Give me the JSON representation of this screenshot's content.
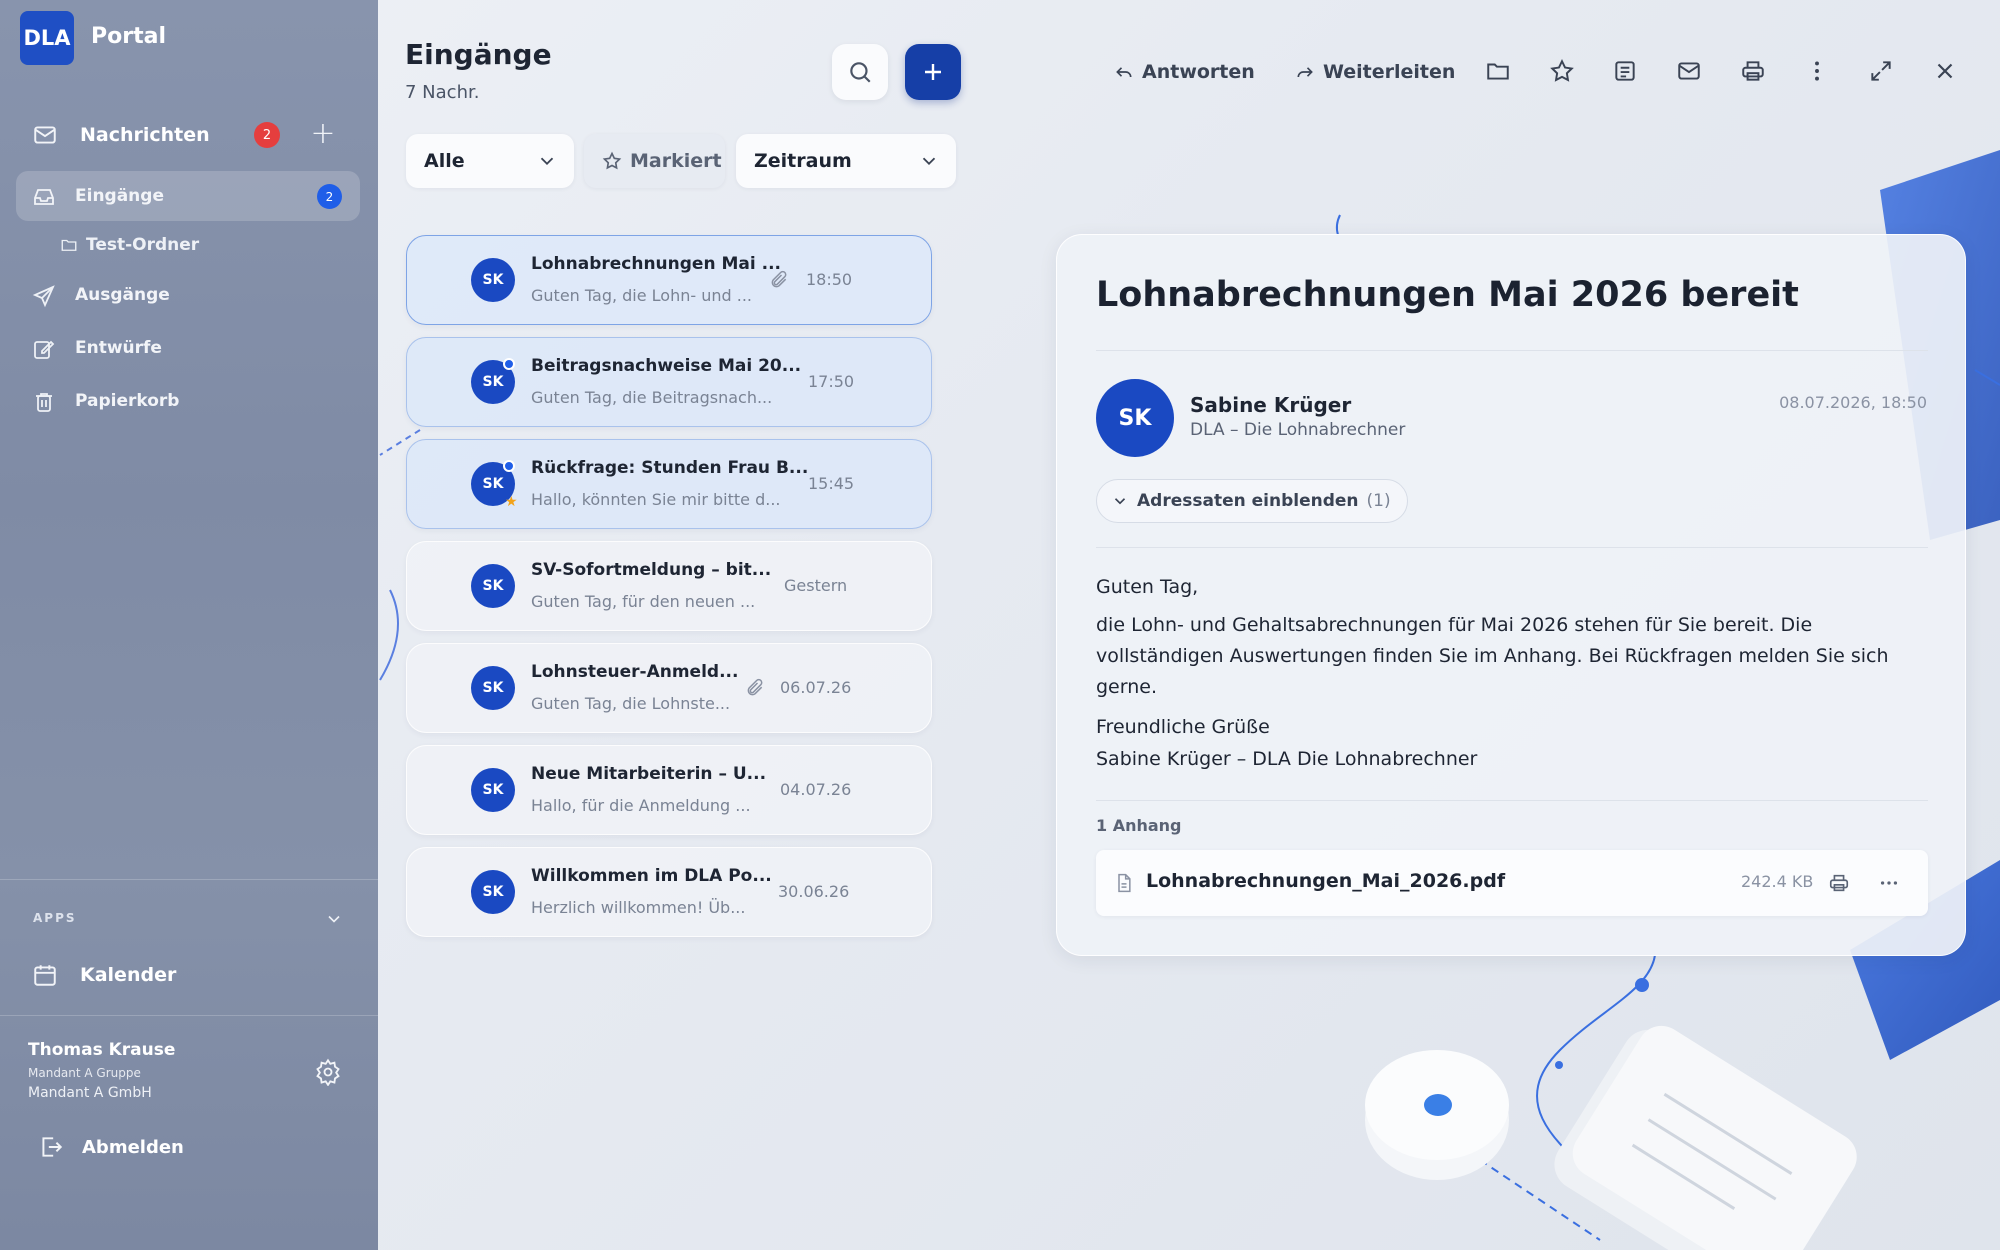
{
  "app": {
    "logo": "DLA",
    "brand": "Portal"
  },
  "sidebar": {
    "messages_label": "Nachrichten",
    "messages_badge": "2",
    "items": [
      {
        "label": "Eingänge",
        "badge": "2",
        "icon": "inbox-icon",
        "active": true
      },
      {
        "label": "Test-Ordner",
        "icon": "folder-icon"
      },
      {
        "label": "Ausgänge",
        "icon": "send-icon"
      },
      {
        "label": "Entwürfe",
        "icon": "edit-icon"
      },
      {
        "label": "Papierkorb",
        "icon": "trash-icon"
      }
    ],
    "apps_label": "APPS",
    "apps": [
      {
        "label": "Kalender",
        "icon": "calendar-icon"
      }
    ],
    "user": {
      "name": "Thomas Krause",
      "group": "Mandant A Gruppe",
      "company": "Mandant A GmbH"
    },
    "logout_label": "Abmelden"
  },
  "header": {
    "title": "Eingänge",
    "count": "7 Nachr.",
    "reply_label": "Antworten",
    "forward_label": "Weiterleiten"
  },
  "filters": {
    "status": "Alle",
    "marked": "Markiert",
    "period": "Zeitraum"
  },
  "messages": [
    {
      "initials": "SK",
      "subject": "Lohnabrechnungen Mai ...",
      "preview": "Guten Tag, die Lohn- und ...",
      "time": "18:50",
      "attachment": true,
      "unread": false,
      "starred": false
    },
    {
      "initials": "SK",
      "subject": "Beitragsnachweise Mai 20...",
      "preview": "Guten Tag, die Beitragsnach...",
      "time": "17:50",
      "attachment": false,
      "unread": true,
      "starred": false
    },
    {
      "initials": "SK",
      "subject": "Rückfrage: Stunden Frau B...",
      "preview": "Hallo, könnten Sie mir bitte d...",
      "time": "15:45",
      "attachment": false,
      "unread": true,
      "starred": true
    },
    {
      "initials": "SK",
      "subject": "SV-Sofortmeldung – bit...",
      "preview": "Guten Tag, für den neuen ...",
      "time": "Gestern",
      "attachment": false,
      "unread": false,
      "starred": false
    },
    {
      "initials": "SK",
      "subject": "Lohnsteuer-Anmeld...",
      "preview": "Guten Tag, die Lohnste...",
      "time": "06.07.26",
      "attachment": true,
      "unread": false,
      "starred": false
    },
    {
      "initials": "SK",
      "subject": "Neue Mitarbeiterin – U...",
      "preview": "Hallo, für die Anmeldung ...",
      "time": "04.07.26",
      "attachment": false,
      "unread": false,
      "starred": false
    },
    {
      "initials": "SK",
      "subject": "Willkommen im DLA Po...",
      "preview": "Herzlich willkommen! Üb...",
      "time": "30.06.26",
      "attachment": false,
      "unread": false,
      "starred": false
    }
  ],
  "reader": {
    "title": "Lohnabrechnungen Mai 2026 bereit",
    "sender_initials": "SK",
    "sender": "Sabine Krüger",
    "sender_org": "DLA – Die Lohnabrechner",
    "date": "08.07.2026, 18:50",
    "recipients_label": "Adressaten einblenden",
    "recipients_count": "(1)",
    "body": {
      "greeting": "Guten Tag,",
      "text": "die Lohn- und Gehaltsabrechnungen für Mai 2026 stehen für Sie bereit. Die vollständigen Auswertungen finden Sie im Anhang. Bei Rückfragen melden Sie sich gerne.",
      "closing": "Freundliche Grüße",
      "signature": "Sabine Krüger – DLA Die Lohnabrechner"
    },
    "attachments_label": "1 Anhang",
    "attachment": {
      "name": "Lohnabrechnungen_Mai_2026.pdf",
      "size": "242.4 KB"
    }
  },
  "colors": {
    "accent": "#163fa7",
    "avatar": "#1a49c2",
    "badge_red": "#e53e3e",
    "badge_blue": "#1f5ee8",
    "star": "#f2a31b"
  }
}
